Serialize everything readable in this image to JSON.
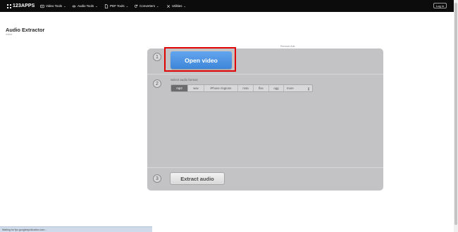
{
  "header": {
    "logo_text": "123APPS",
    "nav": [
      {
        "label": "Video Tools",
        "icon": "video-icon"
      },
      {
        "label": "Audio Tools",
        "icon": "audio-icon"
      },
      {
        "label": "PDF Tools",
        "icon": "pdf-icon"
      },
      {
        "label": "Converters",
        "icon": "converter-icon"
      },
      {
        "label": "Utilities",
        "icon": "utilities-icon"
      }
    ],
    "login_label": "Log in"
  },
  "page": {
    "title": "Audio Extractor",
    "subtitle": "online",
    "remove_ads": "Remove Ads"
  },
  "steps": {
    "one": {
      "number": "1",
      "button_label": "Open video"
    },
    "two": {
      "number": "2",
      "label": "Select audio format:",
      "formats": [
        "mp3",
        "wav",
        "iPhone ringtone",
        "m4a",
        "flac",
        "ogg"
      ],
      "more_label": "more",
      "selected": "mp3"
    },
    "three": {
      "number": "3",
      "button_label": "Extract audio"
    }
  },
  "status_bar": {
    "text": "Waiting for fpc.googlesyndication.com..."
  },
  "colors": {
    "header_bg": "#0c0c0c",
    "panel_bg": "#c3c3c5",
    "primary_button": "#4a91e2",
    "highlight": "#e00000"
  }
}
